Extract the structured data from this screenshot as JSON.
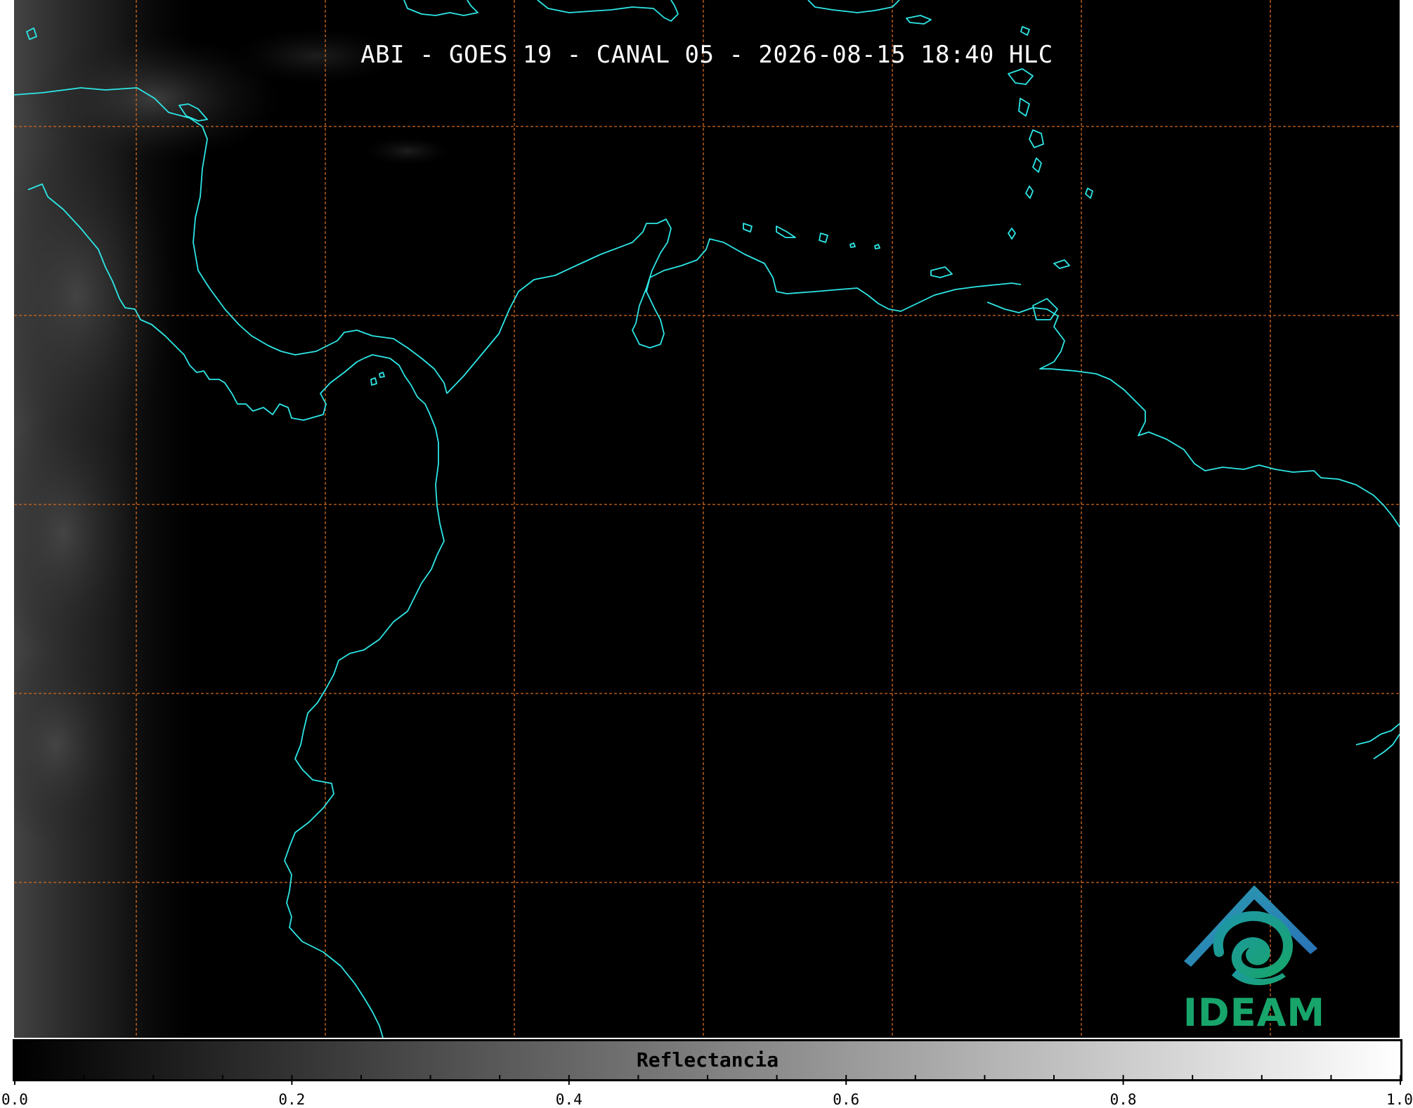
{
  "title": "ABI - GOES 19 - CANAL 05 - 2026-08-15 18:40 HLC",
  "colorbar": {
    "label": "Reflectancia",
    "min": 0.0,
    "max": 1.0,
    "tick_labels": [
      "0.0",
      "0.2",
      "0.4",
      "0.6",
      "0.8",
      "1.0"
    ],
    "major_ticks": [
      0.0,
      0.2,
      0.4,
      0.6,
      0.8,
      1.0
    ],
    "minor_ticks": [
      0.05,
      0.1,
      0.15,
      0.25,
      0.3,
      0.35,
      0.45,
      0.5,
      0.55,
      0.65,
      0.7,
      0.75,
      0.85,
      0.9,
      0.95
    ],
    "colormap": "grayscale"
  },
  "logo": {
    "text": "IDEAM",
    "colors": {
      "text": "#17a56b",
      "roof": "#2a7fb8",
      "swirl": "#1aa59a"
    }
  },
  "map": {
    "background_color": "#000000",
    "coastline_color": "#2ee6e6",
    "gridline_color": "#d2691e",
    "gridline_style": "dashed",
    "graticule_columns": 7,
    "graticule_rows": 5
  }
}
